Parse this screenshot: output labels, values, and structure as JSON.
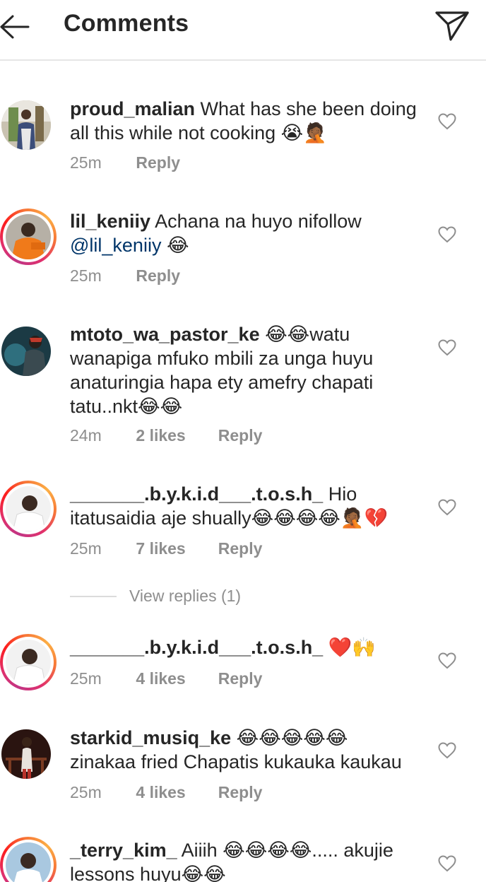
{
  "header": {
    "title": "Comments",
    "back_icon": "arrow-left-icon",
    "send_icon": "paper-plane-icon"
  },
  "comments": [
    {
      "username": "proud_malian",
      "text_lines": [
        "What has she been doing",
        "all this while not cooking 😭🤦🏾"
      ],
      "time": "25m",
      "likes": "",
      "reply": "Reply",
      "story_ring": false
    },
    {
      "username": "lil_keniiy",
      "text_lines": [
        "Achana na huyo nifollow",
        ""
      ],
      "mention": "@lil_keniiy",
      "mention_suffix": " 😂",
      "time": "25m",
      "likes": "",
      "reply": "Reply",
      "story_ring": true
    },
    {
      "username": "mtoto_wa_pastor_ke",
      "text_lines": [
        "😂😂watu",
        "wanapiga mfuko mbili za unga huyu",
        "anaturingia hapa ety amefry chapati",
        "tatu..nkt😂😂"
      ],
      "time": "24m",
      "likes": "2 likes",
      "reply": "Reply",
      "story_ring": false
    },
    {
      "username": "_______.b.y.k.i.d___.t.o.s.h_",
      "text_lines": [
        "Hio",
        "itatusaidia aje shually😂😂😂😂🤦🏾💔"
      ],
      "time": "25m",
      "likes": "7 likes",
      "reply": "Reply",
      "story_ring": true
    },
    {
      "username": "_______.b.y.k.i.d___.t.o.s.h_",
      "text_lines": [
        "❤️🙌"
      ],
      "time": "25m",
      "likes": "4 likes",
      "reply": "Reply",
      "story_ring": true
    },
    {
      "username": "starkid_musiq_ke",
      "text_lines": [
        "😂😂😂😂😂",
        "zinakaa fried Chapatis kukauka kaukau"
      ],
      "time": "25m",
      "likes": "4 likes",
      "reply": "Reply",
      "story_ring": false
    },
    {
      "username": "_terry_kim_",
      "text_lines": [
        "Aiiih 😂😂😂😂..... akujie",
        "lessons huyu😂😂"
      ],
      "time": "",
      "likes": "",
      "reply": "",
      "story_ring": true
    }
  ],
  "view_replies": "View replies (1)",
  "colors": {
    "text": "#262626",
    "secondary": "#8e8e8e",
    "mention": "#003569",
    "divider": "#e6e6e6"
  }
}
